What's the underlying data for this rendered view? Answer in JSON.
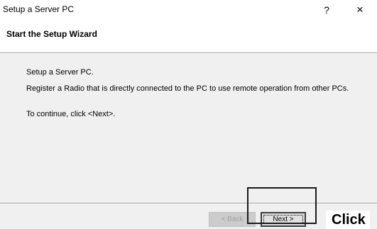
{
  "window": {
    "title": "Setup a Server PC",
    "help_label": "?",
    "close_label": "×"
  },
  "header": {
    "heading": "Start the Setup Wizard"
  },
  "content": {
    "lines": [
      "Setup a Server PC.",
      "Register a Radio that is directly connected to the PC to use remote operation from other PCs.",
      "To continue, click <Next>."
    ]
  },
  "footer": {
    "back_label": "< Back",
    "next_label": "Next >"
  },
  "annotation": {
    "callout_text": "Click"
  }
}
